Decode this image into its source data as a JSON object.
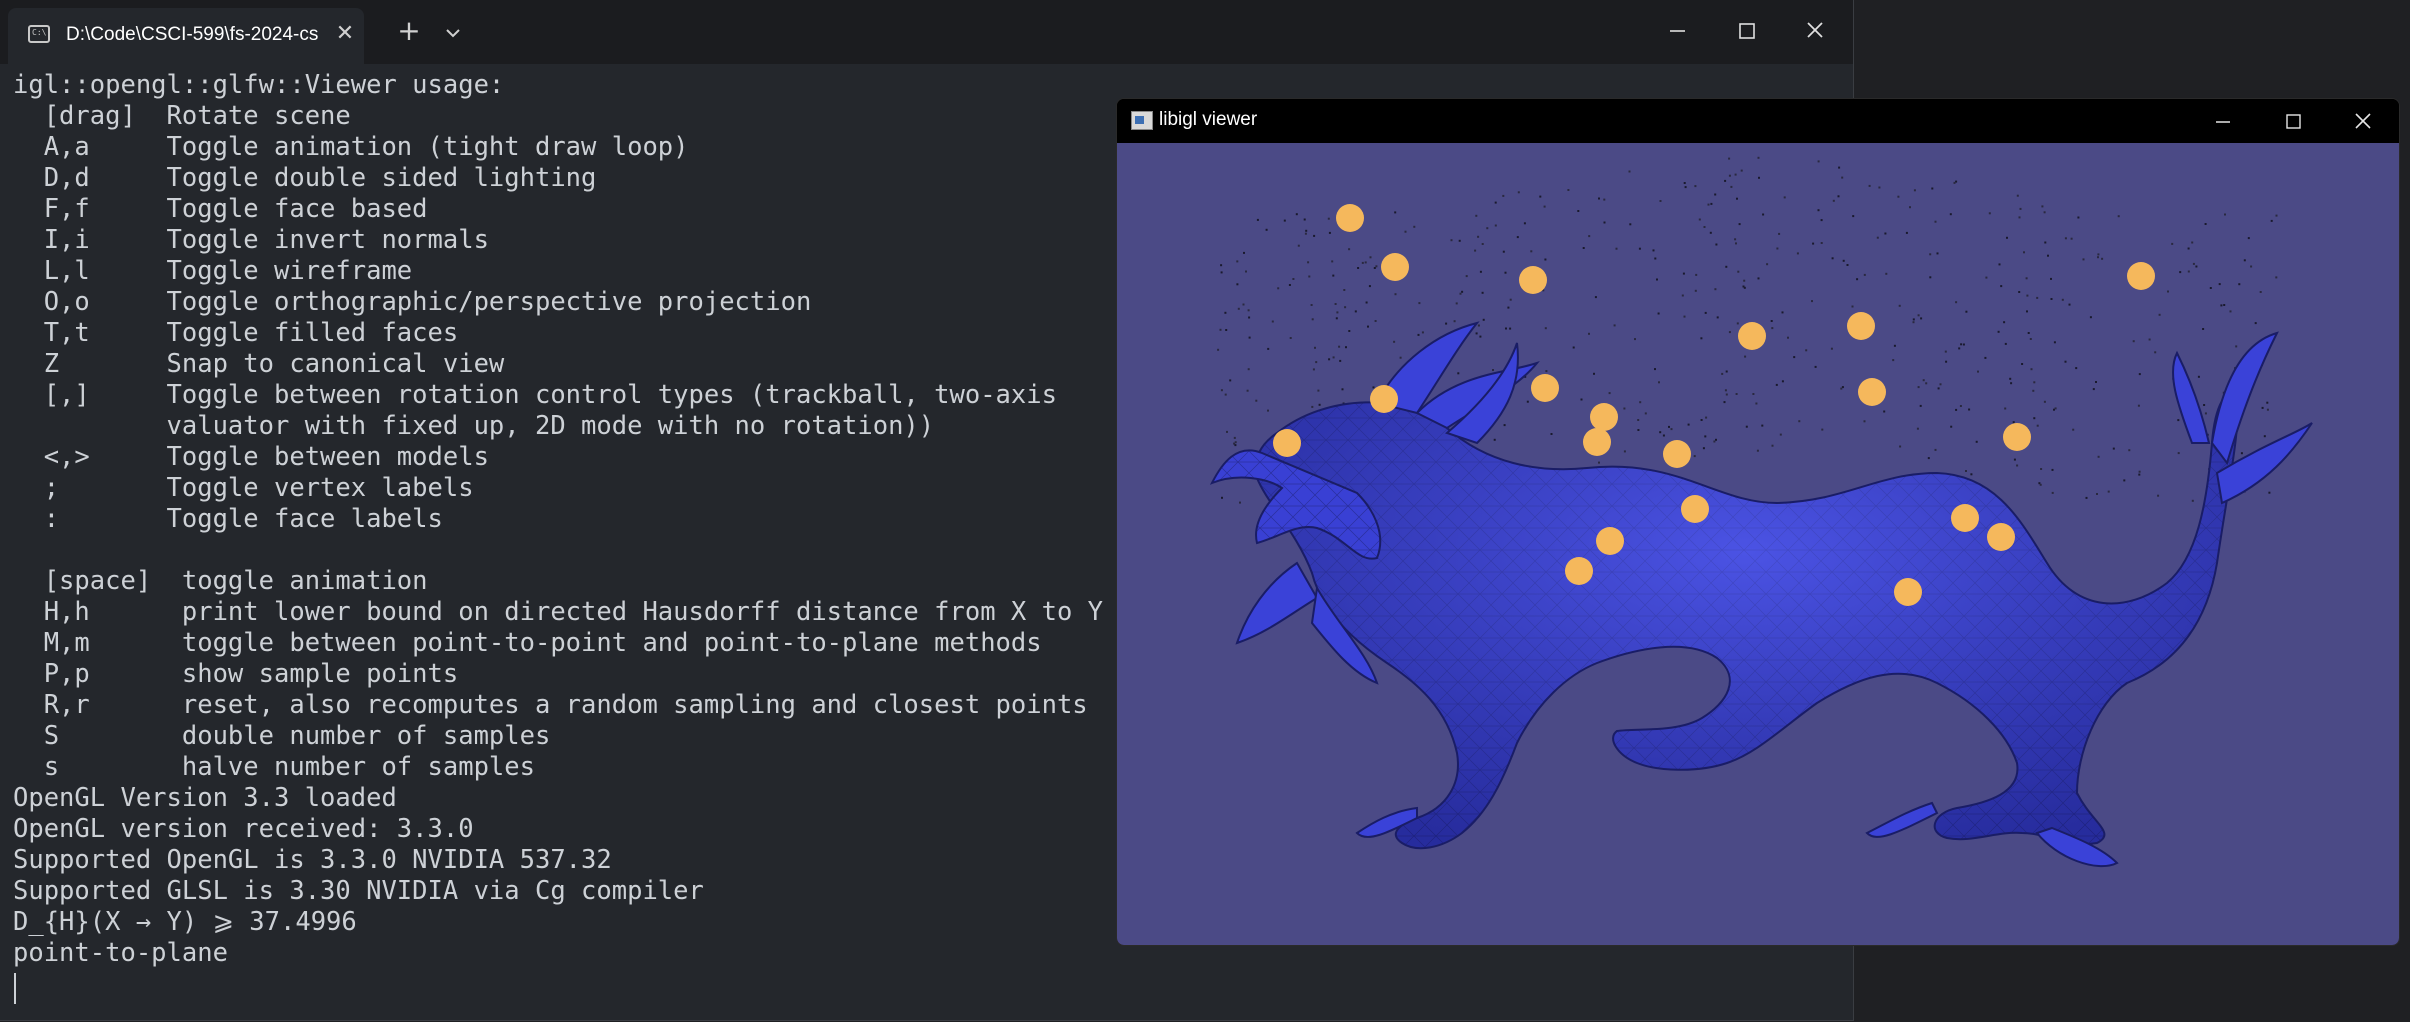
{
  "terminal": {
    "tab_title": "D:\\Code\\CSCI-599\\fs-2024-cs",
    "tab_icon": "terminal-icon",
    "lines": [
      "igl::opengl::glfw::Viewer usage:",
      "  [drag]  Rotate scene",
      "  A,a     Toggle animation (tight draw loop)",
      "  D,d     Toggle double sided lighting",
      "  F,f     Toggle face based",
      "  I,i     Toggle invert normals",
      "  L,l     Toggle wireframe",
      "  O,o     Toggle orthographic/perspective projection",
      "  T,t     Toggle filled faces",
      "  Z       Snap to canonical view",
      "  [,]     Toggle between rotation control types (trackball, two-axis",
      "          valuator with fixed up, 2D mode with no rotation))",
      "  <,>     Toggle between models",
      "  ;       Toggle vertex labels",
      "  :       Toggle face labels",
      "",
      "  [space]  toggle animation",
      "  H,h      print lower bound on directed Hausdorff distance from X to Y",
      "  M,m      toggle between point-to-point and point-to-plane methods",
      "  P,p      show sample points",
      "  R,r      reset, also recomputes a random sampling and closest points",
      "  S        double number of samples",
      "  s        halve number of samples",
      "OpenGL Version 3.3 loaded",
      "OpenGL version received: 3.3.0",
      "Supported OpenGL is 3.3.0 NVIDIA 537.32",
      "Supported GLSL is 3.30 NVIDIA via Cg compiler",
      "D_{H}(X → Y) ⩾ 37.4996",
      "point-to-plane"
    ]
  },
  "viewer": {
    "title": "libigl viewer",
    "background_color": "#4b4a86",
    "mesh_color": "#3a3fd6",
    "sample_point_color": "#f5b85c"
  }
}
